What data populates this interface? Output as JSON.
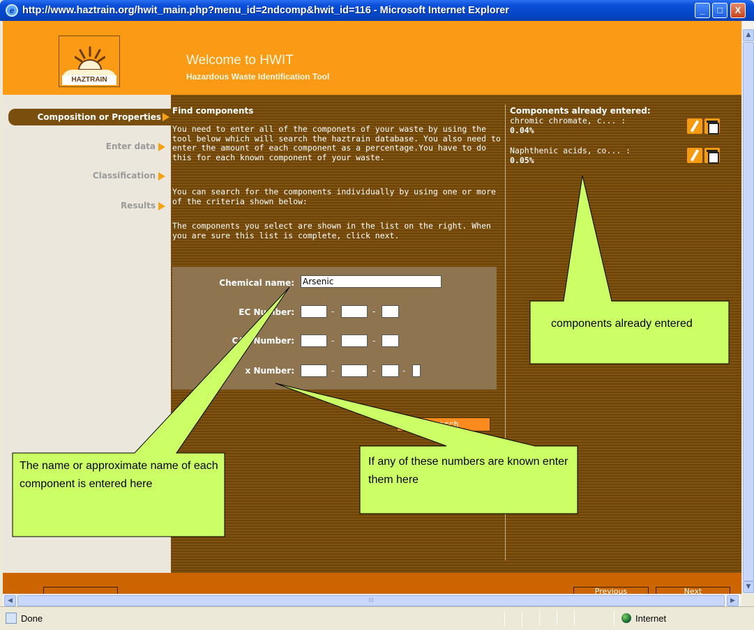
{
  "window": {
    "title": "http://www.haztrain.org/hwit_main.php?menu_id=2ndcomp&hwit_id=116 - Microsoft Internet Explorer",
    "minimize_glyph": "_",
    "maximize_glyph": "□",
    "close_glyph": "X"
  },
  "header": {
    "logo_text": "HAZTRAIN",
    "title": "Welcome to HWIT",
    "subtitle": "Hazardous Waste Identification Tool"
  },
  "nav": {
    "items": [
      {
        "label": "Composition or Properties",
        "active": true
      },
      {
        "label": "Enter data",
        "active": false
      },
      {
        "label": "Classification",
        "active": false
      },
      {
        "label": "Results",
        "active": false
      }
    ]
  },
  "main": {
    "heading": "Find components",
    "paragraph_1": "You need to enter all of the componets of your waste by using the tool below which will search the haztrain database. You also need to enter the amount of each component as a percentage.You have to do this for each known component of your waste.",
    "paragraph_2": "You can search for the components individually by using one or more of the criteria shown below:",
    "paragraph_3": "The components you select are shown in the list on the right. When you are sure this list is complete, click next."
  },
  "form": {
    "chemical_name_label": "Chemical name:",
    "chemical_name_value": "Arsenic",
    "ec_number_label": "EC Number:",
    "cas_number_label": "CAS Number:",
    "index_number_label": "x Number:",
    "dash": "-",
    "search_label": "Search"
  },
  "components": {
    "heading": "Components already entered:",
    "items": [
      {
        "name": "chromic chromate, c... :",
        "percent": "0.04%"
      },
      {
        "name": "Naphthenic acids, co... :",
        "percent": "0.05%"
      }
    ]
  },
  "callouts": {
    "components": "components already entered",
    "name": "The name or approximate name of each component is entered here",
    "numbers": "If any of these numbers are known enter them here"
  },
  "footer": {
    "previous_label": "Previous",
    "next_label": "Next"
  },
  "scrollbar": {
    "up_glyph": "▲",
    "down_glyph": "▼",
    "left_glyph": "◀",
    "right_glyph": "▶",
    "grip_glyph": "III"
  },
  "statusbar": {
    "status": "Done",
    "zone": "Internet"
  },
  "colors": {
    "header_orange": "#fb9a14",
    "main_brown": "#7a4f0e",
    "nav_arrow": "#f6a312",
    "callout_fill": "#ccff66"
  }
}
